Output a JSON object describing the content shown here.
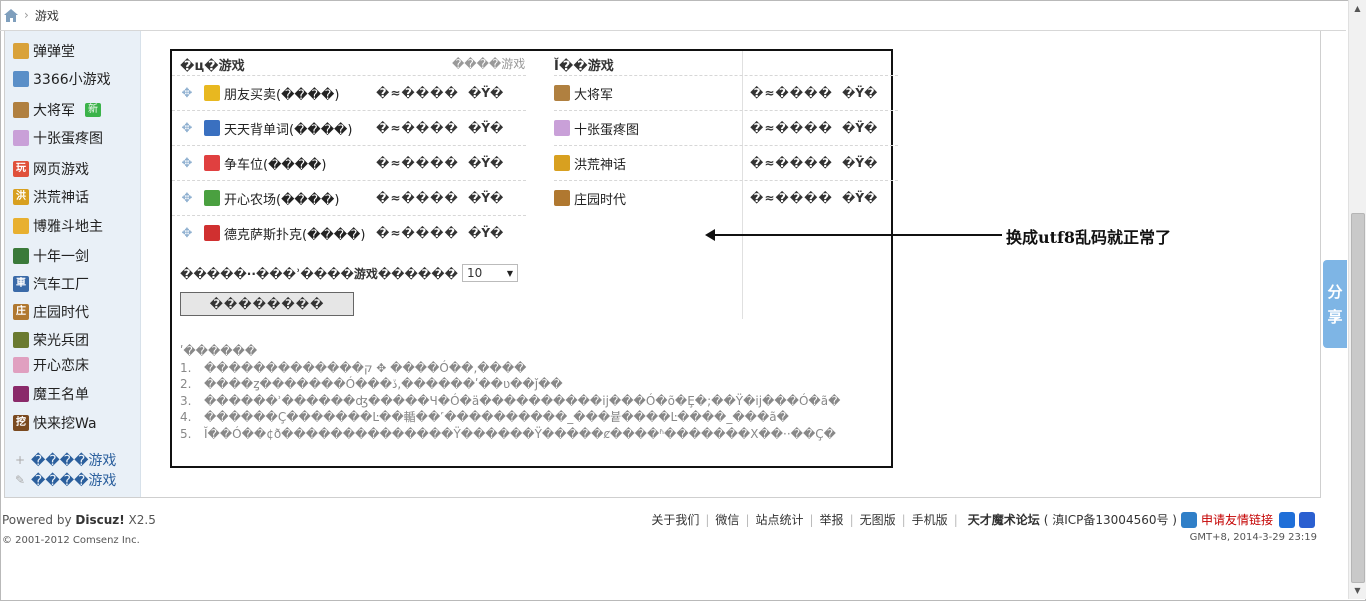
{
  "breadcrumb": {
    "separator": "›",
    "current": "游戏"
  },
  "sidebar": {
    "items": [
      {
        "label": "弹弹堂",
        "icon": "ddtank-icon",
        "color": "#d9a23a",
        "glyph": "",
        "badge": ""
      },
      {
        "label": "3366小游戏",
        "icon": "3366-icon",
        "color": "#5a8fc8",
        "glyph": "",
        "badge": ""
      },
      {
        "label": "大将军",
        "icon": "general-icon",
        "color": "#b08040",
        "glyph": "",
        "badge": "新"
      },
      {
        "label": "十张蛋疼图",
        "icon": "pictures-icon",
        "color": "#c9a0d8",
        "glyph": "",
        "badge": ""
      },
      {
        "label": "网页游戏",
        "icon": "webgame-icon",
        "color": "#e0503a",
        "glyph": "玩",
        "badge": ""
      },
      {
        "label": "洪荒神话",
        "icon": "honghuang-icon",
        "color": "#d8a020",
        "glyph": "洪",
        "badge": ""
      },
      {
        "label": "博雅斗地主",
        "icon": "doudizhu-icon",
        "color": "#e8b030",
        "glyph": "",
        "badge": ""
      },
      {
        "label": "十年一剑",
        "icon": "sword-icon",
        "color": "#3a7a3a",
        "glyph": "",
        "badge": ""
      },
      {
        "label": "汽车工厂",
        "icon": "car-factory-icon",
        "color": "#3a6aa8",
        "glyph": "車",
        "badge": ""
      },
      {
        "label": "庄园时代",
        "icon": "manor-icon",
        "color": "#b07830",
        "glyph": "庄",
        "badge": ""
      },
      {
        "label": "荣光兵团",
        "icon": "legion-icon",
        "color": "#6a7a30",
        "glyph": "",
        "badge": ""
      },
      {
        "label": "开心恋床",
        "icon": "bed-icon",
        "color": "#e0a0c0",
        "glyph": "",
        "badge": ""
      },
      {
        "label": "魔王名单",
        "icon": "demon-icon",
        "color": "#8a2a6a",
        "glyph": "",
        "badge": ""
      },
      {
        "label": "快来挖Wa",
        "icon": "dig-icon",
        "color": "#7a4a20",
        "glyph": "挖",
        "badge": ""
      }
    ],
    "links": [
      {
        "label": "����游戏",
        "icon": "plus-icon"
      },
      {
        "label": "����游戏",
        "icon": "wrench-icon"
      }
    ]
  },
  "panel": {
    "left_header": "�ц�游戏",
    "left_header_right": "����游戏",
    "right_header": "Ĭ��游戏",
    "left_rows": [
      {
        "name": "朋友买卖(����)",
        "col2": "�≈����",
        "col3": "�Ÿ�",
        "icon": "coins-icon",
        "color": "#e8b820"
      },
      {
        "name": "天天背单词(����)",
        "col2": "�≈����",
        "col3": "�Ÿ�",
        "icon": "book-icon",
        "color": "#3a70c0"
      },
      {
        "name": "争车位(����)",
        "col2": "�≈����",
        "col3": "�Ÿ�",
        "icon": "parking-icon",
        "color": "#e04040"
      },
      {
        "name": "开心农场(����)",
        "col2": "�≈����",
        "col3": "�Ÿ�",
        "icon": "sprout-icon",
        "color": "#4aa040"
      },
      {
        "name": "德克萨斯扑克(����)",
        "col2": "�≈����",
        "col3": "�Ÿ�",
        "icon": "poker-chip-icon",
        "color": "#d03030"
      }
    ],
    "right_rows": [
      {
        "name": "大将军",
        "col2": "�≈����",
        "col3": "�Ÿ�",
        "icon": "general-icon",
        "color": "#b08040"
      },
      {
        "name": "十张蛋疼图",
        "col2": "�≈����",
        "col3": "�Ÿ�",
        "icon": "pictures-icon",
        "color": "#c9a0d8"
      },
      {
        "name": "洪荒神话",
        "col2": "�≈����",
        "col3": "�Ÿ�",
        "icon": "honghuang-icon",
        "color": "#d8a020"
      },
      {
        "name": "庄园时代",
        "col2": "�≈����",
        "col3": "�Ÿ�",
        "icon": "manor-icon",
        "color": "#b07830"
      }
    ],
    "setting_label": "�����··���ʾ����游戏������",
    "select_value": "10",
    "submit_label": "��������",
    "notes_title": "ʹ������",
    "notes": [
      "�������������ק ✥ ����Ó��,����",
      "����ȥ�������Ó���ڏ,������ʹ��ʋ��ǰ��",
      "������ʾ������ʤ�����Ч�Ó�ä����������ij���Ó�õ�Ȩ�;��Ÿ�ij���Ó�ã�",
      "������Ç�������Ŀ��輴��˹����������_���븉����Ŀ����_���ã�",
      "Ĭ��Ó��¢ð��������������Ÿ������Ÿ�����ȼ����ʱ�������X��··��Ç�"
    ]
  },
  "annotation": {
    "text": "换成utf8乱码就正常了"
  },
  "footer": {
    "powered_prefix": "Powered by ",
    "powered_brand": "Discuz!",
    "powered_version": " X2.5",
    "copyright": "© 2001-2012 Comsenz Inc.",
    "links": [
      "关于我们",
      "微信",
      "站点统计",
      "举报",
      "无图版",
      "手机版"
    ],
    "site_name": "天才魔术论坛",
    "icp": "( 滇ICP备13004560号 )",
    "apply_link": "申请友情链接",
    "time": "GMT+8, 2014-3-29 23:19"
  },
  "share": {
    "line1": "分",
    "line2": "享"
  }
}
